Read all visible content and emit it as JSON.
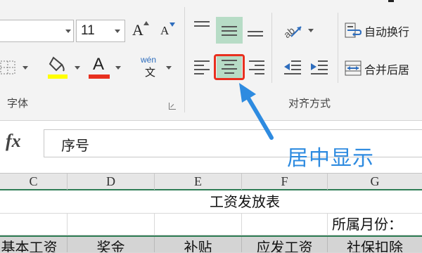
{
  "ribbon": {
    "font_group": {
      "font_size": "11",
      "grow_font_label": "A",
      "shrink_font_label": "A",
      "font_color_label": "A",
      "phonetic_top": "wén",
      "phonetic_bottom": "文",
      "group_label": "字体",
      "fill_color": "#ffff00",
      "font_color": "#e8301f"
    },
    "alignment_group": {
      "group_label": "对齐方式",
      "wrap_text_label": "自动换行",
      "merge_center_label": "合并后居",
      "selected_button_bg": "#b7dcc6",
      "highlight_color": "#e8301f"
    }
  },
  "formula_bar": {
    "fx_label": "fx",
    "value": "序号"
  },
  "annotation": {
    "text": "居中显示",
    "color": "#2e8be0"
  },
  "grid": {
    "column_headers": [
      "C",
      "D",
      "E",
      "F",
      "G"
    ],
    "title": "工资发放表",
    "month_label": "所属月份：",
    "table_headers": [
      "基本工资",
      "奖金",
      "补贴",
      "应发工资",
      "社保扣除"
    ]
  },
  "colors": {
    "ribbon_bg": "#f3f3f3",
    "grid_accent": "#2f7d55",
    "header_fill": "#d4d4d4"
  }
}
